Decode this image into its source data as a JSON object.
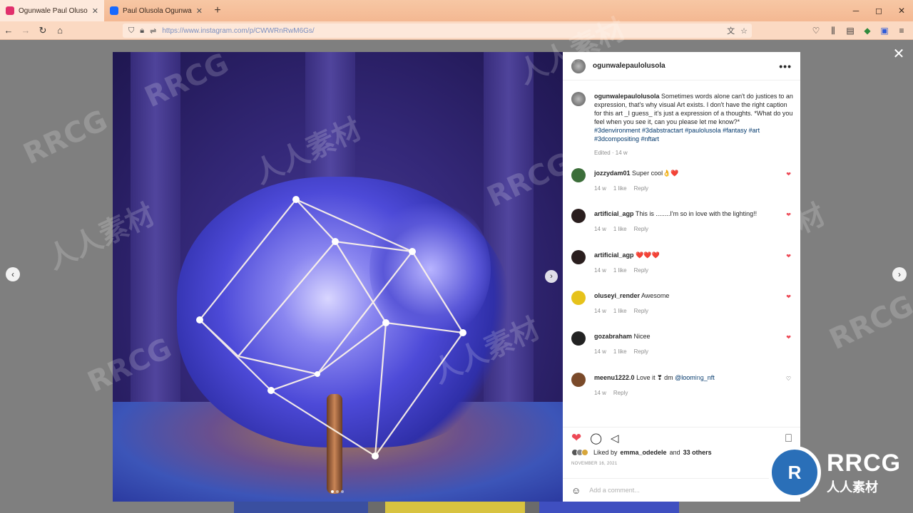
{
  "browser": {
    "tabs": [
      {
        "title": "Ogunwale Paul Olusola (@ogu",
        "active": true,
        "favicon_color": "#e1306c"
      },
      {
        "title": "Paul Olusola Ogunwale on Beh",
        "active": false,
        "favicon_color": "#1769ff"
      }
    ],
    "new_tab": "+",
    "url": "https://www.instagram.com/p/CWWRnRwM6Gs/",
    "window_controls": [
      "─",
      "◻",
      "✕"
    ]
  },
  "post": {
    "username": "ogunwalepaulolusola",
    "more": "•••",
    "caption_user": "ogunwalepaulolusola",
    "caption_text": "Sometimes words alone can't do justices to an expression, that's why visual Art exists. I don't have the right caption for this art _I guess_ it's just a expression of a thoughts. *What do you feel when you see it, can you please let me know?*",
    "caption_tags": "#3denvironment #3dabstractart #paulolusola #fantasy #art #3dcompositing #nftart",
    "caption_meta": "Edited · 14 w",
    "comments": [
      {
        "user": "jozzydam01",
        "text": "Super cool👌❤️",
        "time": "14 w",
        "likes": "1 like",
        "reply": "Reply",
        "liked": true,
        "avatar_color": "#3c6e3a"
      },
      {
        "user": "artificial_agp",
        "text": "This is ........I'm so in love with the lighting!!",
        "time": "14 w",
        "likes": "1 like",
        "reply": "Reply",
        "liked": true,
        "avatar_color": "#2a1e1e"
      },
      {
        "user": "artificial_agp",
        "text": "❤️❤️❤️",
        "time": "14 w",
        "likes": "1 like",
        "reply": "Reply",
        "liked": true,
        "avatar_color": "#2a1e1e"
      },
      {
        "user": "oluseyi_render",
        "text": "Awesome",
        "time": "14 w",
        "likes": "1 like",
        "reply": "Reply",
        "liked": true,
        "avatar_color": "#e6c21b"
      },
      {
        "user": "gozabraham",
        "text": "Nicee",
        "time": "14 w",
        "likes": "1 like",
        "reply": "Reply",
        "liked": true,
        "avatar_color": "#222222"
      },
      {
        "user": "meenu1222.0",
        "text": "Love it ❣ dm ",
        "mention": "@looming_nft",
        "time": "14 w",
        "reply": "Reply",
        "liked": false,
        "avatar_color": "#7a4a2a"
      }
    ],
    "liked_by_prefix": "Liked by",
    "liked_by_user": "emma_odedele",
    "liked_by_and": "and",
    "liked_by_others": "33 others",
    "date": "NOVEMBER 16, 2021",
    "add_comment_placeholder": "Add a comment...",
    "heart_color": "#ed4956"
  },
  "watermark": {
    "brand": "RRCG",
    "sub": "人人素材"
  }
}
